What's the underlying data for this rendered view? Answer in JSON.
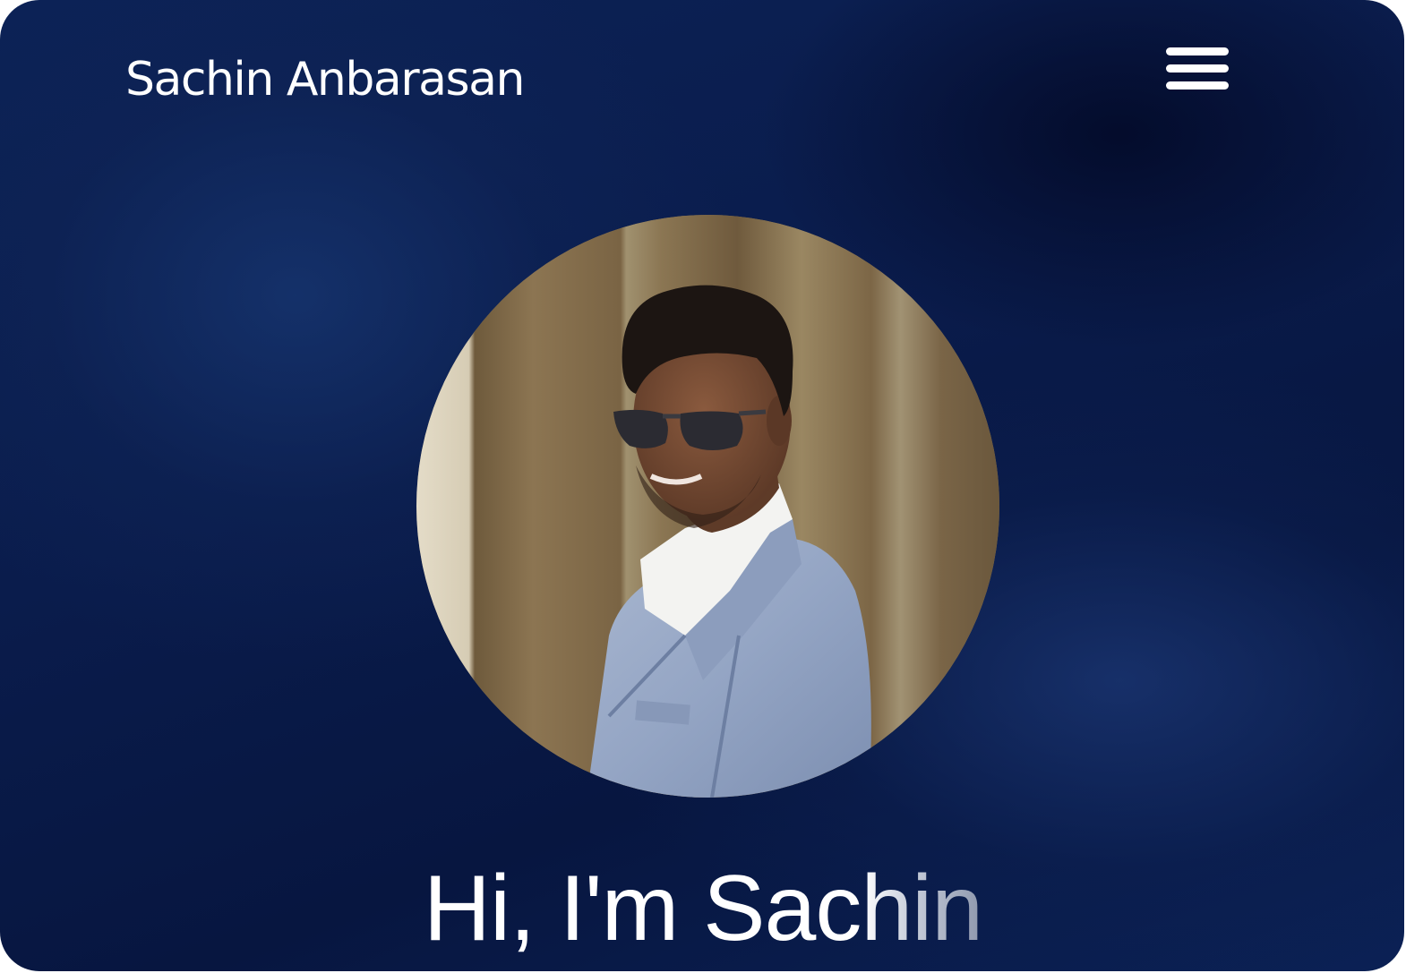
{
  "header": {
    "brand_name": "Sachin Anbarasan",
    "menu_icon": "hamburger-menu-icon"
  },
  "hero": {
    "avatar_alt": "Portrait photo",
    "greeting_solid": "Hi, I'm Sac",
    "greeting_fading": "hin"
  },
  "colors": {
    "background": "#0a1c4c",
    "text": "#ffffff"
  }
}
